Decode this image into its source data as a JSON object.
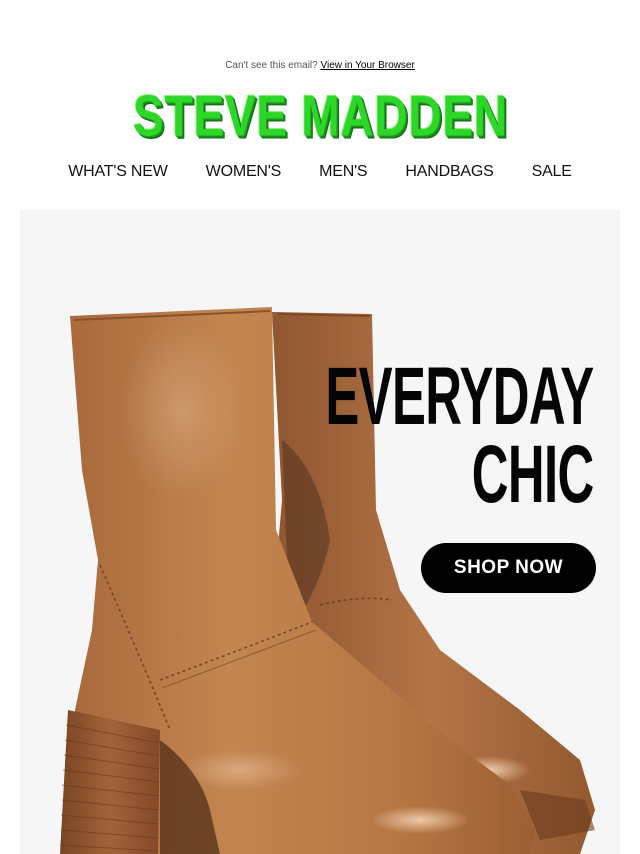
{
  "preheader": {
    "text": "Can't see this email?",
    "link_label": "View in Your Browser"
  },
  "brand": {
    "logo_text": "STEVE MADDEN",
    "logo_color": "#2fd62a"
  },
  "nav": {
    "items": [
      {
        "label": "WHAT'S NEW"
      },
      {
        "label": "WOMEN'S"
      },
      {
        "label": "MEN'S"
      },
      {
        "label": "HANDBAGS"
      },
      {
        "label": "SALE"
      }
    ]
  },
  "hero": {
    "headline_line1": "EVERYDAY",
    "headline_line2": "CHIC",
    "cta_label": "SHOP NOW",
    "background_color": "#f6f6f7",
    "image": "brown-leather-platform-boots"
  }
}
